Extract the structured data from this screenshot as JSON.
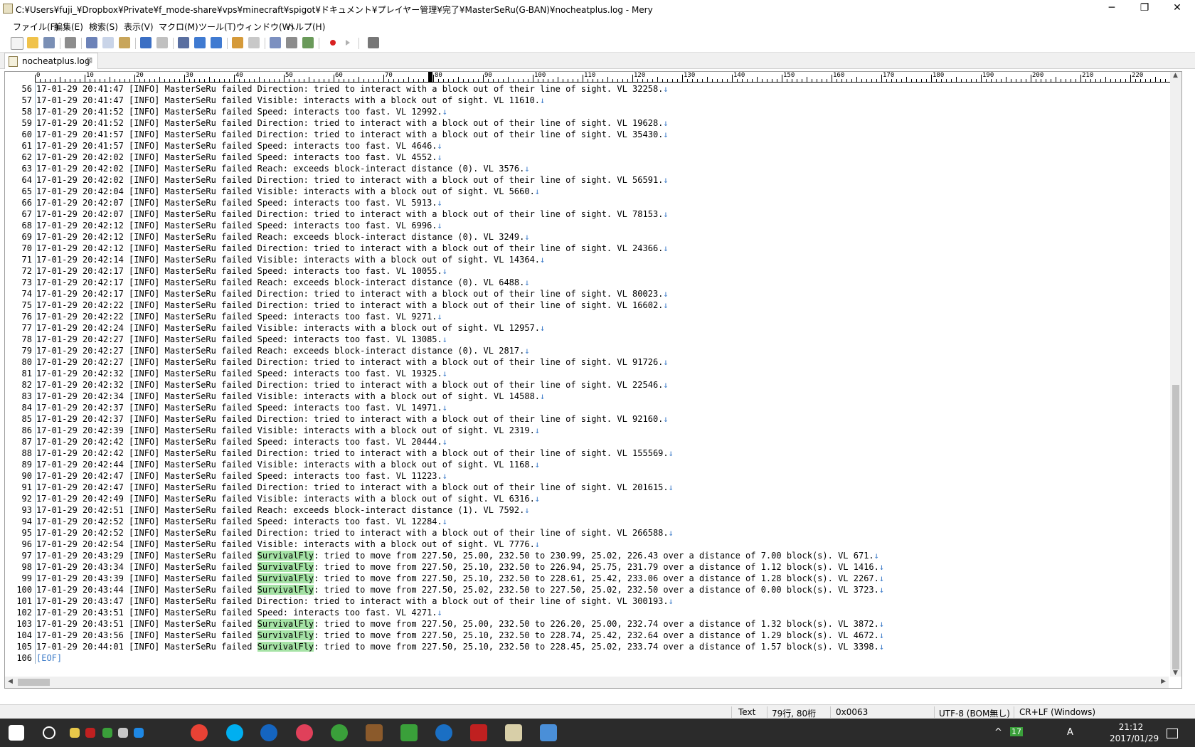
{
  "window": {
    "title": "C:¥Users¥fuji_¥Dropbox¥Private¥f_mode-share¥vps¥minecraft¥spigot¥ドキュメント¥プレイヤー管理¥完了¥MasterSeRu(G-BAN)¥nocheatplus.log - Mery",
    "minimize": "─",
    "maximize": "❐",
    "close": "✕"
  },
  "menu": [
    "ファイル(F)",
    "編集(E)",
    "検索(S)",
    "表示(V)",
    "マクロ(M)",
    "ツール(T)",
    "ウィンドウ(W)",
    "ヘルプ(H)"
  ],
  "tab": {
    "name": "nocheatplus.log",
    "close": "⊠"
  },
  "ruler": [
    "0",
    "10",
    "20",
    "30",
    "40",
    "50",
    "60",
    "70",
    "80",
    "90",
    "100",
    "110",
    "120",
    "130",
    "140",
    "150",
    "160",
    "170",
    "180",
    "190",
    "200",
    "210",
    "220"
  ],
  "lines": [
    {
      "n": "56",
      "pre": "17-01-29 20:41:47 [INFO] MasterSeRu failed Direction: tried to interact with a block out of their line of sight. VL 32258."
    },
    {
      "n": "57",
      "pre": "17-01-29 20:41:47 [INFO] MasterSeRu failed Visible: interacts with a block out of sight. VL 11610."
    },
    {
      "n": "58",
      "pre": "17-01-29 20:41:52 [INFO] MasterSeRu failed Speed: interacts too fast. VL 12992."
    },
    {
      "n": "59",
      "pre": "17-01-29 20:41:52 [INFO] MasterSeRu failed Direction: tried to interact with a block out of their line of sight. VL 19628."
    },
    {
      "n": "60",
      "pre": "17-01-29 20:41:57 [INFO] MasterSeRu failed Direction: tried to interact with a block out of their line of sight. VL 35430."
    },
    {
      "n": "61",
      "pre": "17-01-29 20:41:57 [INFO] MasterSeRu failed Speed: interacts too fast. VL 4646."
    },
    {
      "n": "62",
      "pre": "17-01-29 20:42:02 [INFO] MasterSeRu failed Speed: interacts too fast. VL 4552."
    },
    {
      "n": "63",
      "pre": "17-01-29 20:42:02 [INFO] MasterSeRu failed Reach: exceeds block-interact distance (0). VL 3576."
    },
    {
      "n": "64",
      "pre": "17-01-29 20:42:02 [INFO] MasterSeRu failed Direction: tried to interact with a block out of their line of sight. VL 56591."
    },
    {
      "n": "65",
      "pre": "17-01-29 20:42:04 [INFO] MasterSeRu failed Visible: interacts with a block out of sight. VL 5660."
    },
    {
      "n": "66",
      "pre": "17-01-29 20:42:07 [INFO] MasterSeRu failed Speed: interacts too fast. VL 5913."
    },
    {
      "n": "67",
      "pre": "17-01-29 20:42:07 [INFO] MasterSeRu failed Direction: tried to interact with a block out of their line of sight. VL 78153."
    },
    {
      "n": "68",
      "pre": "17-01-29 20:42:12 [INFO] MasterSeRu failed Speed: interacts too fast. VL 6996."
    },
    {
      "n": "69",
      "pre": "17-01-29 20:42:12 [INFO] MasterSeRu failed Reach: exceeds block-interact distance (0). VL 3249."
    },
    {
      "n": "70",
      "pre": "17-01-29 20:42:12 [INFO] MasterSeRu failed Direction: tried to interact with a block out of their line of sight. VL 24366."
    },
    {
      "n": "71",
      "pre": "17-01-29 20:42:14 [INFO] MasterSeRu failed Visible: interacts with a block out of sight. VL 14364."
    },
    {
      "n": "72",
      "pre": "17-01-29 20:42:17 [INFO] MasterSeRu failed Speed: interacts too fast. VL 10055."
    },
    {
      "n": "73",
      "pre": "17-01-29 20:42:17 [INFO] MasterSeRu failed Reach: exceeds block-interact distance (0). VL 6488."
    },
    {
      "n": "74",
      "pre": "17-01-29 20:42:17 [INFO] MasterSeRu failed Direction: tried to interact with a block out of their line of sight. VL 80023."
    },
    {
      "n": "75",
      "pre": "17-01-29 20:42:22 [INFO] MasterSeRu failed Direction: tried to interact with a block out of their line of sight. VL 16602."
    },
    {
      "n": "76",
      "pre": "17-01-29 20:42:22 [INFO] MasterSeRu failed Speed: interacts too fast. VL 9271."
    },
    {
      "n": "77",
      "pre": "17-01-29 20:42:24 [INFO] MasterSeRu failed Visible: interacts with a block out of sight. VL 12957."
    },
    {
      "n": "78",
      "pre": "17-01-29 20:42:27 [INFO] MasterSeRu failed Speed: interacts too fast. VL 13085."
    },
    {
      "n": "79",
      "pre": "17-01-29 20:42:27 [INFO] MasterSeRu failed Reach: exceeds block-interact distance (0). VL 2817."
    },
    {
      "n": "80",
      "pre": "17-01-29 20:42:27 [INFO] MasterSeRu failed Direction: tried to interact with a block out of their line of sight. VL 91726."
    },
    {
      "n": "81",
      "pre": "17-01-29 20:42:32 [INFO] MasterSeRu failed Speed: interacts too fast. VL 19325."
    },
    {
      "n": "82",
      "pre": "17-01-29 20:42:32 [INFO] MasterSeRu failed Direction: tried to interact with a block out of their line of sight. VL 22546."
    },
    {
      "n": "83",
      "pre": "17-01-29 20:42:34 [INFO] MasterSeRu failed Visible: interacts with a block out of sight. VL 14588."
    },
    {
      "n": "84",
      "pre": "17-01-29 20:42:37 [INFO] MasterSeRu failed Speed: interacts too fast. VL 14971."
    },
    {
      "n": "85",
      "pre": "17-01-29 20:42:37 [INFO] MasterSeRu failed Direction: tried to interact with a block out of their line of sight. VL 92160."
    },
    {
      "n": "86",
      "pre": "17-01-29 20:42:39 [INFO] MasterSeRu failed Visible: interacts with a block out of sight. VL 2319."
    },
    {
      "n": "87",
      "pre": "17-01-29 20:42:42 [INFO] MasterSeRu failed Speed: interacts too fast. VL 20444."
    },
    {
      "n": "88",
      "pre": "17-01-29 20:42:42 [INFO] MasterSeRu failed Direction: tried to interact with a block out of their line of sight. VL 155569."
    },
    {
      "n": "89",
      "pre": "17-01-29 20:42:44 [INFO] MasterSeRu failed Visible: interacts with a block out of sight. VL 1168."
    },
    {
      "n": "90",
      "pre": "17-01-29 20:42:47 [INFO] MasterSeRu failed Speed: interacts too fast. VL 11223."
    },
    {
      "n": "91",
      "pre": "17-01-29 20:42:47 [INFO] MasterSeRu failed Direction: tried to interact with a block out of their line of sight. VL 201615."
    },
    {
      "n": "92",
      "pre": "17-01-29 20:42:49 [INFO] MasterSeRu failed Visible: interacts with a block out of sight. VL 6316."
    },
    {
      "n": "93",
      "pre": "17-01-29 20:42:51 [INFO] MasterSeRu failed Reach: exceeds block-interact distance (1). VL 7592."
    },
    {
      "n": "94",
      "pre": "17-01-29 20:42:52 [INFO] MasterSeRu failed Speed: interacts too fast. VL 12284."
    },
    {
      "n": "95",
      "pre": "17-01-29 20:42:52 [INFO] MasterSeRu failed Direction: tried to interact with a block out of their line of sight. VL 266588."
    },
    {
      "n": "96",
      "pre": "17-01-29 20:42:54 [INFO] MasterSeRu failed Visible: interacts with a block out of sight. VL 7776."
    },
    {
      "n": "97",
      "pre": "17-01-29 20:43:29 [INFO] MasterSeRu failed ",
      "hl": "SurvivalFly",
      "post": ": tried to move from 227.50, 25.00, 232.50 to 230.99, 25.02, 226.43 over a distance of 7.00 block(s). VL 671."
    },
    {
      "n": "98",
      "pre": "17-01-29 20:43:34 [INFO] MasterSeRu failed ",
      "hl": "SurvivalFly",
      "post": ": tried to move from 227.50, 25.10, 232.50 to 226.94, 25.75, 231.79 over a distance of 1.12 block(s). VL 1416."
    },
    {
      "n": "99",
      "pre": "17-01-29 20:43:39 [INFO] MasterSeRu failed ",
      "hl": "SurvivalFly",
      "post": ": tried to move from 227.50, 25.10, 232.50 to 228.61, 25.42, 233.06 over a distance of 1.28 block(s). VL 2267."
    },
    {
      "n": "100",
      "pre": "17-01-29 20:43:44 [INFO] MasterSeRu failed ",
      "hl": "SurvivalFly",
      "post": ": tried to move from 227.50, 25.02, 232.50 to 227.50, 25.02, 232.50 over a distance of 0.00 block(s). VL 3723."
    },
    {
      "n": "101",
      "pre": "17-01-29 20:43:47 [INFO] MasterSeRu failed Direction: tried to interact with a block out of their line of sight. VL 300193."
    },
    {
      "n": "102",
      "pre": "17-01-29 20:43:51 [INFO] MasterSeRu failed Speed: interacts too fast. VL 4271."
    },
    {
      "n": "103",
      "pre": "17-01-29 20:43:51 [INFO] MasterSeRu failed ",
      "hl": "SurvivalFly",
      "post": ": tried to move from 227.50, 25.00, 232.50 to 226.20, 25.00, 232.74 over a distance of 1.32 block(s). VL 3872."
    },
    {
      "n": "104",
      "pre": "17-01-29 20:43:56 [INFO] MasterSeRu failed ",
      "hl": "SurvivalFly",
      "post": ": tried to move from 227.50, 25.10, 232.50 to 228.74, 25.42, 232.64 over a distance of 1.29 block(s). VL 4672."
    },
    {
      "n": "105",
      "pre": "17-01-29 20:44:01 [INFO] MasterSeRu failed ",
      "hl": "SurvivalFly",
      "post": ": tried to move from 227.50, 25.10, 232.50 to 228.45, 25.02, 233.74 over a distance of 1.57 block(s). VL 3398."
    }
  ],
  "newline_mark": "↓",
  "eof_line": {
    "n": "106",
    "text": "[EOF]"
  },
  "status": {
    "mode": "Text",
    "position": "79行, 80桁",
    "code": "0x0063",
    "encoding": "UTF-8 (BOM無し)",
    "line_ending": "CR+LF (Windows)"
  },
  "taskbar": {
    "tray_arrow": "^",
    "badge": "17",
    "ime": "A",
    "time": "21:12",
    "date": "2017/01/29"
  },
  "colors": {
    "highlight": "#a6e3a6",
    "newline": "#3c7bc8",
    "taskbar": "#2b2b2b"
  }
}
